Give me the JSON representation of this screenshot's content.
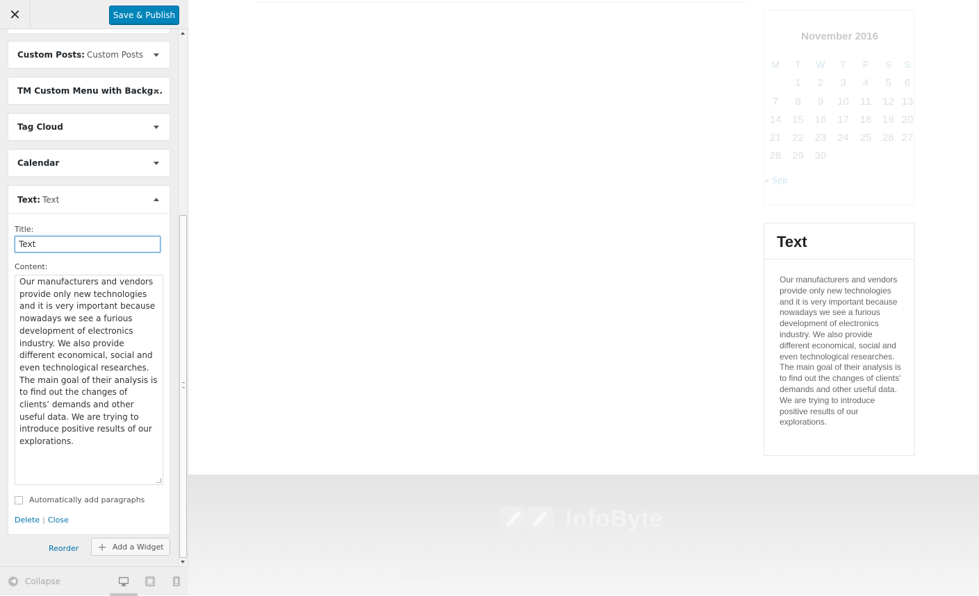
{
  "topbar": {
    "close_glyph": "✕",
    "publish_label": "Save & Publish"
  },
  "widgets": {
    "custom_posts": {
      "name": "Custom Posts:",
      "sub": "Custom Posts"
    },
    "tm_menu": {
      "name": "TM Custom Menu with Backg..."
    },
    "tag_cloud": {
      "name": "Tag Cloud"
    },
    "calendar": {
      "name": "Calendar"
    },
    "text": {
      "name": "Text:",
      "sub": "Text",
      "title_label": "Title:",
      "title_value": "Text",
      "content_label": "Content:",
      "content_value": "Our manufacturers and vendors provide only new technologies and it is very important because nowadays we see a furious development of electronics industry. We also provide different economical, social and even technological researches. The main goal of their analysis is to find out the changes of clients’ demands and other useful data. We are trying to introduce positive results of our explorations.",
      "autop_label": "Automatically add paragraphs",
      "delete_label": "Delete",
      "link_sep": "|",
      "close_label": "Close"
    }
  },
  "actions": {
    "reorder_label": "Reorder",
    "add_widget_label": "Add a Widget",
    "add_glyph": "+"
  },
  "footer": {
    "collapse_label": "Collapse",
    "collapse_glyph": "◀",
    "devices": [
      "desktop-icon",
      "tablet-icon",
      "mobile-icon"
    ]
  },
  "preview": {
    "calendar": {
      "title": "November 2016",
      "weekdays": [
        "M",
        "T",
        "W",
        "T",
        "F",
        "S",
        "S"
      ],
      "weeks": [
        [
          "",
          "1",
          "2",
          "3",
          "4",
          "5",
          "6"
        ],
        [
          "7",
          "8",
          "9",
          "10",
          "11",
          "12",
          "13"
        ],
        [
          "14",
          "15",
          "16",
          "17",
          "18",
          "19",
          "20"
        ],
        [
          "21",
          "22",
          "23",
          "24",
          "25",
          "26",
          "27"
        ],
        [
          "28",
          "29",
          "30",
          "",
          "",
          "",
          ""
        ]
      ],
      "prev_link": "« Sep"
    },
    "text_widget": {
      "title": "Text",
      "body": "Our manufacturers and vendors provide only new technologies and it is very important because nowadays we see a furious development of electronics industry. We also provide different economical, social and even technological researches. The main goal of their analysis is to find out the changes of clients’ demands and other useful data. We are trying to introduce positive results of our explorations."
    },
    "site_footer": {
      "logo_text": "InfoByte",
      "credit_brand": "InfoByte",
      "credit_text": "is proudly powered by WordPress Entries (RSS) and Comments (RSS) Privacy Policy"
    }
  },
  "colors": {
    "accent": "#0085ba",
    "link": "#0073aa",
    "sidebar_bg": "#eeeeee"
  }
}
